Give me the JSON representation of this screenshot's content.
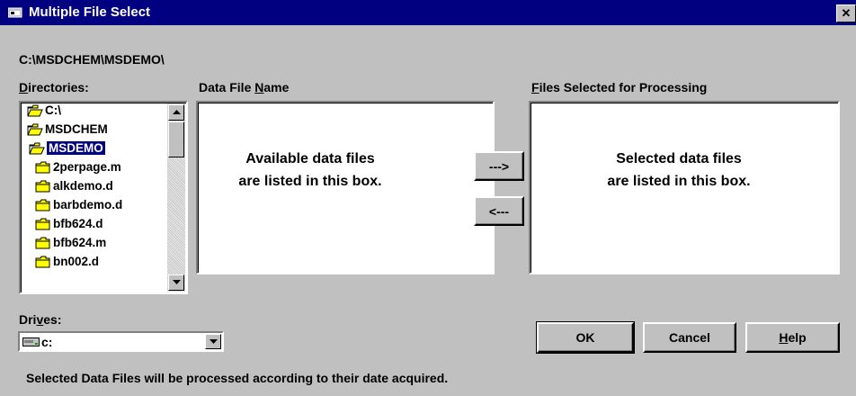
{
  "window": {
    "title": "Multiple File Select",
    "close_glyph": "✕",
    "icon": "window-icon"
  },
  "path": "C:\\MSDCHEM\\MSDEMO\\",
  "labels": {
    "directories_pre": "",
    "directories_key": "D",
    "directories_post": "irectories:",
    "data_file_pre": "Data File ",
    "data_file_key": "N",
    "data_file_post": "ame",
    "files_selected_pre": "",
    "files_selected_key": "F",
    "files_selected_post": "iles Selected for Processing",
    "drives_pre": "Dri",
    "drives_key": "v",
    "drives_post": "es:"
  },
  "directories": [
    {
      "name": "C:\\",
      "icon": "open-folder-icon",
      "selected": false
    },
    {
      "name": "MSDCHEM",
      "icon": "open-folder-icon",
      "selected": false
    },
    {
      "name": "MSDEMO",
      "icon": "open-folder-icon",
      "selected": true
    },
    {
      "name": "2perpage.m",
      "icon": "folder-icon",
      "selected": false
    },
    {
      "name": "alkdemo.d",
      "icon": "folder-icon",
      "selected": false
    },
    {
      "name": "barbdemo.d",
      "icon": "folder-icon",
      "selected": false
    },
    {
      "name": "bfb624.d",
      "icon": "folder-icon",
      "selected": false
    },
    {
      "name": "bfb624.m",
      "icon": "folder-icon",
      "selected": false
    },
    {
      "name": "bn002.d",
      "icon": "folder-icon",
      "selected": false
    }
  ],
  "available_box": {
    "line1": "Available data files",
    "line2": "are listed in this box."
  },
  "selected_box": {
    "line1": "Selected data files",
    "line2": "are listed in this box."
  },
  "buttons": {
    "add": "--->",
    "remove": "<---",
    "ok": "OK",
    "cancel": "Cancel",
    "help_key": "H",
    "help_rest": "elp"
  },
  "drive": {
    "value": "c:",
    "icon": "drive-icon"
  },
  "footer": "Selected Data Files will be processed according to their date acquired.",
  "colors": {
    "face": "#c0c0c0",
    "title_bar": "#000080",
    "selection": "#000080",
    "folder": "#ffff00"
  }
}
